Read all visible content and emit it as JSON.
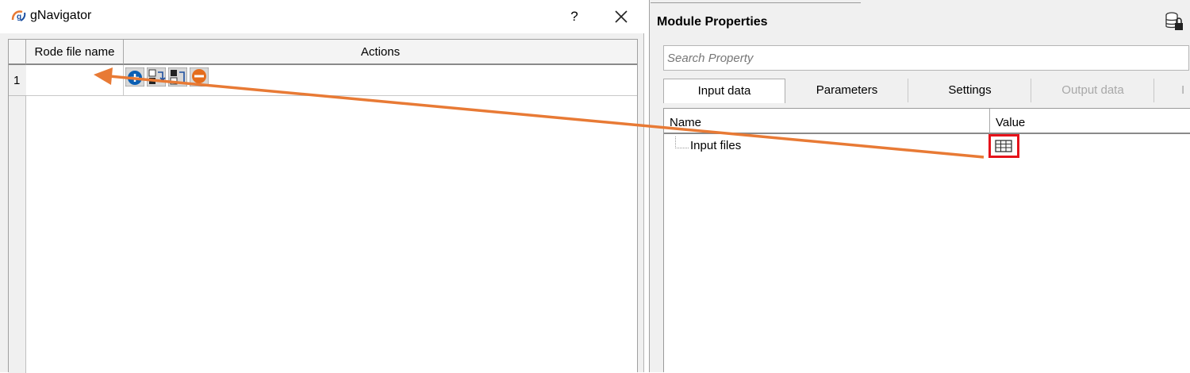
{
  "dialog": {
    "title": "gNavigator",
    "help_label": "?",
    "columns": [
      "Rode file name",
      "Actions"
    ],
    "rows": [
      {
        "number": "1",
        "rode_file_name": "",
        "actions": [
          "add-icon",
          "replace-icon",
          "cut-icon",
          "remove-icon"
        ]
      }
    ]
  },
  "panel": {
    "title": "Module Properties",
    "search_placeholder": "Search Property",
    "tabs": [
      {
        "label": "Input data",
        "state": "active"
      },
      {
        "label": "Parameters",
        "state": "normal"
      },
      {
        "label": "Settings",
        "state": "normal"
      },
      {
        "label": "Output data",
        "state": "disabled"
      },
      {
        "label": "I",
        "state": "disabled"
      }
    ],
    "table": {
      "columns": [
        "Name",
        "Value"
      ],
      "rows": [
        {
          "name": "Input files",
          "value_icon": "table-icon"
        }
      ]
    }
  },
  "colors": {
    "arrow": "#e87a35",
    "highlight": "#e5131b",
    "action_blue": "#0a5fb4",
    "action_orange": "#e56d1d"
  }
}
